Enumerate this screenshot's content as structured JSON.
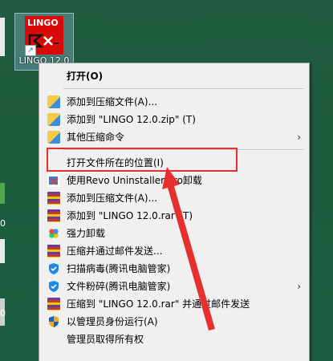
{
  "desktop": {
    "icon_label": "LINGO 12.0",
    "logo_text": "LINGO",
    "edge_digit_1": "0",
    "edge_digit_2": "0"
  },
  "menu": {
    "items": [
      {
        "label": "打开(O)",
        "icon": "none",
        "bold": true
      },
      {
        "label": "添加到压缩文件(A)...",
        "icon": "zip-archive-icon"
      },
      {
        "label": "添加到 \"LINGO 12.0.zip\" (T)",
        "icon": "zip-archive-icon"
      },
      {
        "label": "其他压缩命令",
        "icon": "zip-archive-icon",
        "submenu": true
      },
      {
        "label": "打开文件所在的位置(I)",
        "icon": "none"
      },
      {
        "label": "使用Revo Uninstaller Pro卸载",
        "icon": "revo-uninstaller-icon"
      },
      {
        "label": "添加到压缩文件(A)...",
        "icon": "winrar-icon"
      },
      {
        "label": "添加到 \"LINGO 12.0.rar\"(T)",
        "icon": "winrar-icon"
      },
      {
        "label": "强力卸载",
        "icon": "flower-icon"
      },
      {
        "label": "压缩并通过邮件发送...",
        "icon": "winrar-icon"
      },
      {
        "label": "扫描病毒(腾讯电脑管家)",
        "icon": "shield-icon"
      },
      {
        "label": "文件粉碎(腾讯电脑管家)",
        "icon": "shield-icon",
        "submenu": true
      },
      {
        "label": "压缩到 \"LINGO 12.0.rar\" 并通过邮件发送",
        "icon": "winrar-icon"
      },
      {
        "label": "以管理员身份运行(A)",
        "icon": "uac-shield-icon"
      },
      {
        "label": "管理员取得所有权",
        "icon": "none"
      }
    ],
    "submenu_arrow": "›"
  },
  "colors": {
    "highlight": "#e63030",
    "desktop": "#1e5a3f",
    "menu_bg": "#f0f0f0"
  }
}
